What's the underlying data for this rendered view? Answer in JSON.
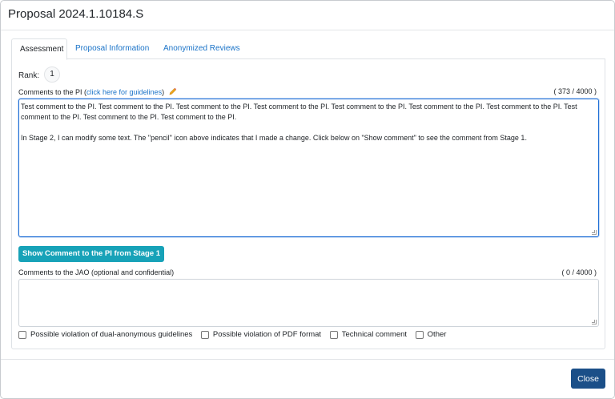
{
  "dialog": {
    "title": "Proposal 2024.1.10184.S"
  },
  "tabs": [
    {
      "label": "Assessment",
      "active": true
    },
    {
      "label": "Proposal Information",
      "active": false
    },
    {
      "label": "Anonymized Reviews",
      "active": false
    }
  ],
  "rank": {
    "label": "Rank:",
    "value": "1"
  },
  "pi_comments": {
    "label_prefix": "Comments to the PI (",
    "guidelines_link": "click here for guidelines",
    "label_suffix": ")",
    "edited_icon": "pencil-icon",
    "counter": "( 373 / 4000 )",
    "paragraph1": "Test comment to the PI. Test comment to the PI. Test comment to the PI. Test comment to the PI. Test comment to the PI. Test comment to the PI. Test comment to the PI. Test comment to the PI. Test comment to the PI. Test comment to the PI.",
    "paragraph2": "In Stage 2, I can modify some text.  The \"pencil\" icon above indicates that I made a change. Click below on \"Show comment\" to see the comment from Stage 1."
  },
  "show_comment_button": "Show Comment to the PI from Stage 1",
  "jao_comments": {
    "label": "Comments to the JAO (optional and confidential)",
    "counter": "( 0 / 4000 )",
    "value": ""
  },
  "checkboxes": [
    {
      "label": "Possible violation of dual-anonymous guidelines",
      "checked": false
    },
    {
      "label": "Possible violation of PDF format",
      "checked": false
    },
    {
      "label": "Technical comment",
      "checked": false
    },
    {
      "label": "Other",
      "checked": false
    }
  ],
  "footer": {
    "close_label": "Close"
  },
  "colors": {
    "link": "#1a73c8",
    "teal_button": "#17a2b8",
    "close_button": "#1b4f88",
    "focus_border": "#1f6fd6"
  }
}
